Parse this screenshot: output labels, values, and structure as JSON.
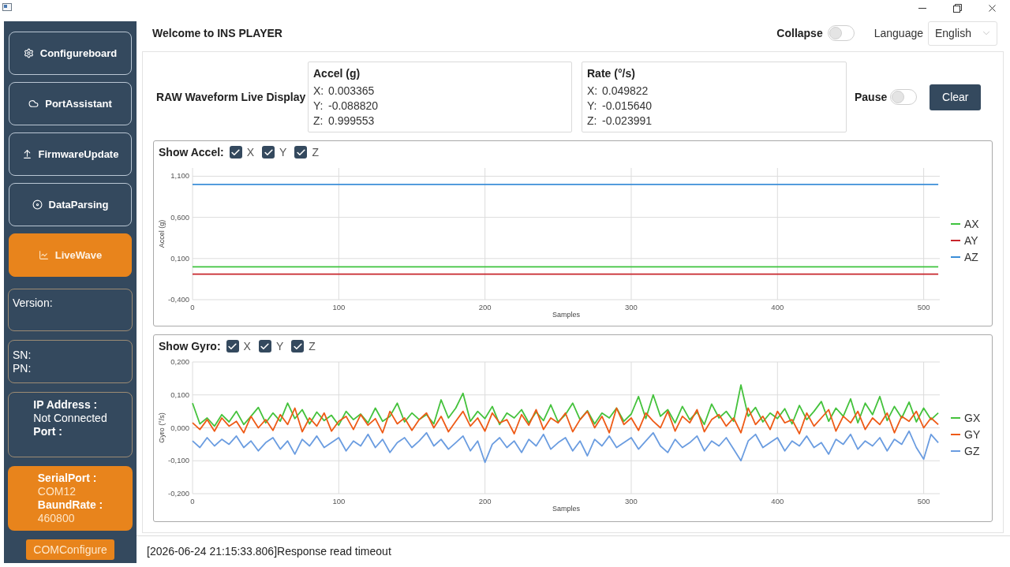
{
  "sidebar": {
    "nav": [
      {
        "label": "Configureboard",
        "selected": false
      },
      {
        "label": "PortAssistant",
        "selected": false
      },
      {
        "label": "FirmwareUpdate",
        "selected": false
      },
      {
        "label": "DataParsing",
        "selected": false
      },
      {
        "label": "LiveWave",
        "selected": true
      }
    ],
    "version": {
      "label": "Version:"
    },
    "identity": {
      "sn_label": "SN:",
      "pn_label": "PN:"
    },
    "network": {
      "ip_label": "IP Address :",
      "ip_value": "Not Connected",
      "port_label": "Port :"
    },
    "serial": {
      "port_label": "SerialPort :",
      "port_value": "COM12",
      "baud_label": "BaundRate :",
      "baud_value": "460800"
    },
    "com_button": "COMConfigure"
  },
  "header": {
    "title": "Welcome to INS PLAYER",
    "collapse": {
      "label": "Collapse",
      "on": false
    },
    "language": {
      "label": "Language",
      "value": "English"
    }
  },
  "live_display": {
    "title": "RAW Waveform Live Display",
    "readouts": [
      {
        "title": "Accel (g)",
        "rows": [
          {
            "axis": "X:",
            "value": "0.003365"
          },
          {
            "axis": "Y:",
            "value": "-0.088820"
          },
          {
            "axis": "Z:",
            "value": "0.999553"
          }
        ]
      },
      {
        "title": "Rate (°/s)",
        "rows": [
          {
            "axis": "X:",
            "value": "0.049822"
          },
          {
            "axis": "Y:",
            "value": "-0.015640"
          },
          {
            "axis": "Z:",
            "value": "-0.023991"
          }
        ]
      }
    ],
    "pause": {
      "label": "Pause",
      "on": false
    },
    "clear_button": "Clear"
  },
  "charts": [
    {
      "show_label": "Show Accel:",
      "toggles": [
        {
          "label": "X",
          "checked": true
        },
        {
          "label": "Y",
          "checked": true
        },
        {
          "label": "Z",
          "checked": true
        }
      ],
      "chart_data": {
        "type": "line",
        "xlabel": "Samples",
        "ylabel": "Accel (g)",
        "x": [
          0,
          510
        ],
        "series": [
          {
            "name": "AX",
            "color": "#3ec43e",
            "values": [
              0,
              0
            ]
          },
          {
            "name": "AY",
            "color": "#c8262c",
            "values": [
              -0.09,
              -0.09
            ]
          },
          {
            "name": "AZ",
            "color": "#3b8ed8",
            "values": [
              1.0,
              1.0
            ]
          }
        ],
        "xlim": [
          0,
          511
        ],
        "ylim": [
          -0.4,
          1.2
        ],
        "xticks": [
          0,
          100,
          200,
          300,
          400,
          500
        ],
        "yticks": [
          {
            "value": -0.4,
            "label": "-0,400"
          },
          {
            "value": 0.1,
            "label": "0,100"
          },
          {
            "value": 0.6,
            "label": "0,600"
          },
          {
            "value": 1.1,
            "label": "1,100"
          }
        ],
        "grid": true,
        "legend": true
      }
    },
    {
      "show_label": "Show Gyro:",
      "toggles": [
        {
          "label": "X",
          "checked": true
        },
        {
          "label": "Y",
          "checked": true
        },
        {
          "label": "Z",
          "checked": true
        }
      ],
      "chart_data": {
        "type": "line",
        "xlabel": "Samples",
        "ylabel": "Gyro (°/s)",
        "x": [
          0,
          5,
          10,
          15,
          20,
          25,
          30,
          35,
          40,
          45,
          50,
          55,
          60,
          65,
          70,
          75,
          80,
          85,
          90,
          95,
          100,
          105,
          110,
          115,
          120,
          125,
          130,
          135,
          140,
          145,
          150,
          155,
          160,
          165,
          170,
          175,
          180,
          185,
          190,
          195,
          200,
          205,
          210,
          215,
          220,
          225,
          230,
          235,
          240,
          245,
          250,
          255,
          260,
          265,
          270,
          275,
          280,
          285,
          290,
          295,
          300,
          305,
          310,
          315,
          320,
          325,
          330,
          335,
          340,
          345,
          350,
          355,
          360,
          365,
          370,
          375,
          380,
          385,
          390,
          395,
          400,
          405,
          410,
          415,
          420,
          425,
          430,
          435,
          440,
          445,
          450,
          455,
          460,
          465,
          470,
          475,
          480,
          485,
          490,
          495,
          500,
          505,
          510
        ],
        "series": [
          {
            "name": "GX",
            "color": "#44c23c",
            "values": [
              0.075,
              0.012,
              0.03,
              0.005,
              0.04,
              0.018,
              0.05,
              0.01,
              0.035,
              0.062,
              0.015,
              0.045,
              0.02,
              0.075,
              0.028,
              0.055,
              0.012,
              0.048,
              0.022,
              0.038,
              0.008,
              0.05,
              0.025,
              0.042,
              0.015,
              0.06,
              0.02,
              0.035,
              0.075,
              0.018,
              0.045,
              0.025,
              0.04,
              0.012,
              0.085,
              0.03,
              0.06,
              0.105,
              0.02,
              0.05,
              0.028,
              0.065,
              0.01,
              0.045,
              0.03,
              0.055,
              0.015,
              0.048,
              0.022,
              0.07,
              0.018,
              0.04,
              0.075,
              0.025,
              0.052,
              0.012,
              0.045,
              0.03,
              0.06,
              0.02,
              0.042,
              0.095,
              0.028,
              0.1,
              0.035,
              0.055,
              0.015,
              0.065,
              0.025,
              0.048,
              0.01,
              0.072,
              0.03,
              0.05,
              0.02,
              0.13,
              0.035,
              0.062,
              0.018,
              0.045,
              0.028,
              0.058,
              0.012,
              0.068,
              0.025,
              0.05,
              0.08,
              0.02,
              0.06,
              0.035,
              0.088,
              0.015,
              0.075,
              0.04,
              0.095,
              0.022,
              0.065,
              0.03,
              0.078,
              0.018,
              0.06,
              0.025,
              0.045
            ]
          },
          {
            "name": "GY",
            "color": "#ee5a16",
            "values": [
              0.015,
              -0.005,
              0.025,
              -0.01,
              0.03,
              0.005,
              0.02,
              -0.015,
              0.035,
              0.0,
              0.025,
              -0.008,
              0.04,
              0.01,
              0.06,
              -0.012,
              0.03,
              0.005,
              0.045,
              -0.01,
              0.02,
              0.035,
              -0.005,
              0.04,
              0.008,
              0.028,
              -0.015,
              0.05,
              0.012,
              0.03,
              -0.008,
              0.025,
              0.045,
              0.0,
              0.035,
              -0.012,
              0.02,
              0.05,
              0.005,
              0.03,
              -0.01,
              0.045,
              0.015,
              0.025,
              -0.018,
              0.04,
              0.008,
              0.055,
              -0.005,
              0.03,
              0.015,
              0.045,
              -0.012,
              0.025,
              0.05,
              0.0,
              0.035,
              -0.015,
              0.06,
              0.01,
              0.03,
              -0.008,
              0.045,
              0.02,
              0.0,
              0.05,
              -0.01,
              0.035,
              0.015,
              0.055,
              -0.012,
              0.025,
              0.04,
              0.005,
              0.03,
              -0.015,
              0.06,
              0.01,
              0.035,
              -0.005,
              0.05,
              0.015,
              0.025,
              -0.018,
              0.045,
              0.005,
              0.03,
              0.055,
              -0.01,
              0.035,
              0.015,
              0.05,
              -0.005,
              0.03,
              0.01,
              0.045,
              -0.015,
              0.035,
              0.02,
              0.05,
              0.0,
              0.03,
              0.01
            ]
          },
          {
            "name": "GZ",
            "color": "#6a9ce0",
            "values": [
              -0.04,
              -0.06,
              -0.03,
              -0.055,
              -0.035,
              -0.05,
              -0.025,
              -0.06,
              -0.04,
              -0.07,
              -0.045,
              -0.03,
              -0.065,
              -0.04,
              -0.08,
              -0.035,
              -0.055,
              -0.025,
              -0.06,
              -0.045,
              -0.03,
              -0.07,
              -0.04,
              -0.055,
              -0.02,
              -0.06,
              -0.035,
              -0.075,
              -0.045,
              -0.03,
              -0.06,
              -0.04,
              -0.015,
              -0.055,
              -0.035,
              -0.065,
              -0.045,
              -0.025,
              -0.07,
              -0.04,
              -0.105,
              -0.05,
              -0.03,
              -0.06,
              -0.04,
              -0.075,
              -0.035,
              -0.055,
              -0.02,
              -0.065,
              -0.045,
              -0.03,
              -0.07,
              -0.04,
              -0.085,
              -0.035,
              -0.055,
              -0.025,
              -0.06,
              -0.045,
              -0.03,
              -0.065,
              -0.04,
              -0.015,
              -0.055,
              -0.075,
              -0.035,
              -0.06,
              -0.045,
              -0.025,
              -0.07,
              -0.04,
              -0.055,
              -0.03,
              -0.065,
              -0.1,
              -0.04,
              -0.02,
              -0.06,
              -0.045,
              -0.03,
              -0.07,
              -0.04,
              -0.055,
              -0.025,
              -0.06,
              -0.045,
              -0.08,
              -0.035,
              -0.05,
              -0.02,
              -0.065,
              -0.04,
              -0.055,
              -0.03,
              -0.07,
              -0.035,
              -0.05,
              -0.01,
              -0.06,
              -0.095,
              -0.02,
              -0.045
            ]
          }
        ],
        "xlim": [
          0,
          511
        ],
        "ylim": [
          -0.2,
          0.2
        ],
        "xticks": [
          0,
          100,
          200,
          300,
          400,
          500
        ],
        "yticks": [
          {
            "value": -0.2,
            "label": "-0,200"
          },
          {
            "value": -0.1,
            "label": "-0,100"
          },
          {
            "value": 0,
            "label": "0,000"
          },
          {
            "value": 0.1,
            "label": "0,100"
          },
          {
            "value": 0.2,
            "label": "0,200"
          }
        ],
        "grid": true,
        "legend": true
      }
    }
  ],
  "status_bar": {
    "message": "[2026-06-24 21:15:33.806]Response read timeout"
  }
}
